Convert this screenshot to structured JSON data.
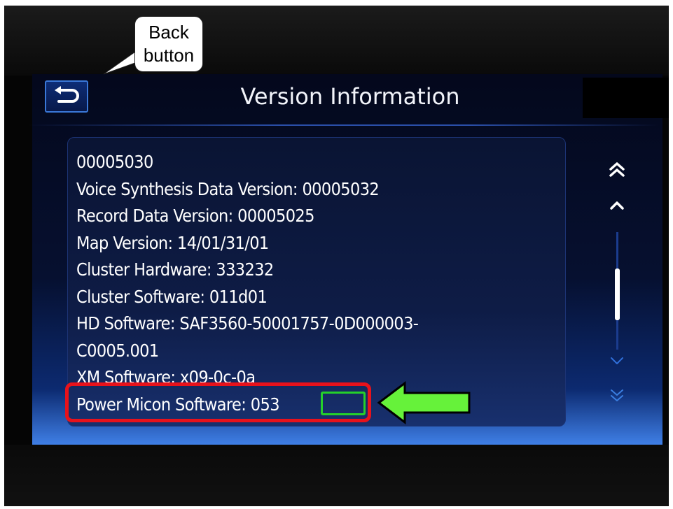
{
  "screen": {
    "title": "Version Information"
  },
  "version_lines": [
    "00005030",
    "Voice Synthesis Data Version: 00005032",
    "Record Data Version: 00005025",
    "Map Version: 14/01/31/01",
    "Cluster Hardware: 333232",
    "Cluster Software: 011d01",
    "HD Software:  SAF3560-50001757-0D000003-",
    "C0005.001",
    "XM Software: x09-0c-0a",
    "Power Micon Software: 053"
  ],
  "highlight": {
    "label": "Power Micon Software:",
    "value": "053"
  },
  "scrollbar": {
    "position": 0.55
  },
  "callout": {
    "line1": "Back",
    "line2": "button"
  },
  "icons": {
    "back": "return-arrow-icon",
    "page_up": "double-chevron-up-icon",
    "up": "chevron-up-icon",
    "down": "chevron-down-icon",
    "page_down": "double-chevron-down-icon",
    "pointer": "green-arrow-icon"
  },
  "colors": {
    "highlight_border": "#e8121b",
    "value_border": "#25d02a",
    "arrow_fill": "#66f23a",
    "accent": "#3a78d8"
  }
}
